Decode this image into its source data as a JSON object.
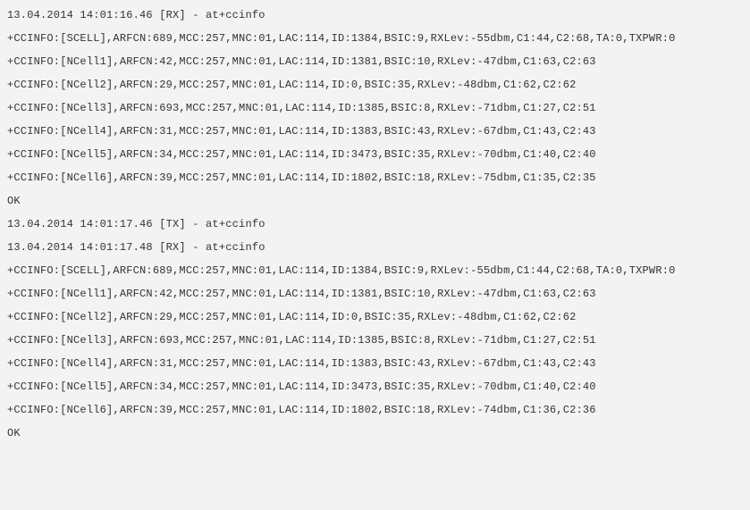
{
  "log": {
    "lines": [
      "13.04.2014 14:01:16.46 [RX] - at+ccinfo",
      "+CCINFO:[SCELL],ARFCN:689,MCC:257,MNC:01,LAC:114,ID:1384,BSIC:9,RXLev:-55dbm,C1:44,C2:68,TA:0,TXPWR:0",
      "+CCINFO:[NCell1],ARFCN:42,MCC:257,MNC:01,LAC:114,ID:1381,BSIC:10,RXLev:-47dbm,C1:63,C2:63",
      "+CCINFO:[NCell2],ARFCN:29,MCC:257,MNC:01,LAC:114,ID:0,BSIC:35,RXLev:-48dbm,C1:62,C2:62",
      "+CCINFO:[NCell3],ARFCN:693,MCC:257,MNC:01,LAC:114,ID:1385,BSIC:8,RXLev:-71dbm,C1:27,C2:51",
      "+CCINFO:[NCell4],ARFCN:31,MCC:257,MNC:01,LAC:114,ID:1383,BSIC:43,RXLev:-67dbm,C1:43,C2:43",
      "+CCINFO:[NCell5],ARFCN:34,MCC:257,MNC:01,LAC:114,ID:3473,BSIC:35,RXLev:-70dbm,C1:40,C2:40",
      "+CCINFO:[NCell6],ARFCN:39,MCC:257,MNC:01,LAC:114,ID:1802,BSIC:18,RXLev:-75dbm,C1:35,C2:35",
      "OK",
      "13.04.2014 14:01:17.46 [TX] - at+ccinfo",
      "13.04.2014 14:01:17.48 [RX] - at+ccinfo",
      "+CCINFO:[SCELL],ARFCN:689,MCC:257,MNC:01,LAC:114,ID:1384,BSIC:9,RXLev:-55dbm,C1:44,C2:68,TA:0,TXPWR:0",
      "+CCINFO:[NCell1],ARFCN:42,MCC:257,MNC:01,LAC:114,ID:1381,BSIC:10,RXLev:-47dbm,C1:63,C2:63",
      "+CCINFO:[NCell2],ARFCN:29,MCC:257,MNC:01,LAC:114,ID:0,BSIC:35,RXLev:-48dbm,C1:62,C2:62",
      "+CCINFO:[NCell3],ARFCN:693,MCC:257,MNC:01,LAC:114,ID:1385,BSIC:8,RXLev:-71dbm,C1:27,C2:51",
      "+CCINFO:[NCell4],ARFCN:31,MCC:257,MNC:01,LAC:114,ID:1383,BSIC:43,RXLev:-67dbm,C1:43,C2:43",
      "+CCINFO:[NCell5],ARFCN:34,MCC:257,MNC:01,LAC:114,ID:3473,BSIC:35,RXLev:-70dbm,C1:40,C2:40",
      "+CCINFO:[NCell6],ARFCN:39,MCC:257,MNC:01,LAC:114,ID:1802,BSIC:18,RXLev:-74dbm,C1:36,C2:36",
      "OK"
    ]
  }
}
